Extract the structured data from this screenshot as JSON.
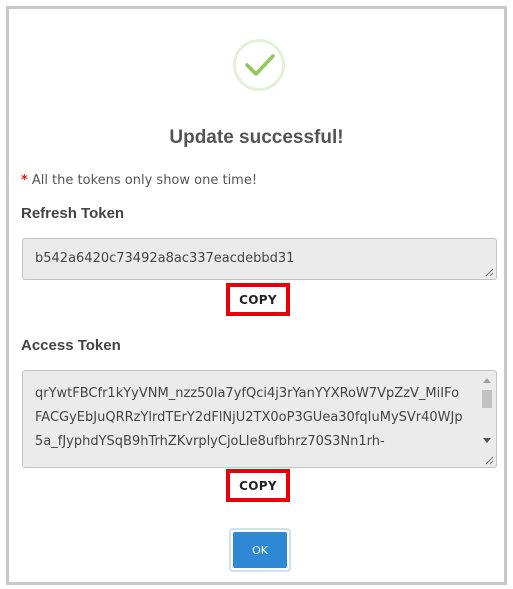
{
  "dialog": {
    "icon": "success-check-icon",
    "title": "Update successful!",
    "note": {
      "star": "*",
      "text": "All the tokens only show one time!"
    },
    "refresh_token": {
      "label": "Refresh Token",
      "value": "b542a6420c73492a8ac337eacdebbd31",
      "copy_label": "COPY"
    },
    "access_token": {
      "label": "Access Token",
      "lines": [
        "qrYwtFBCfr1kYyVNM_nzz50Ia7yfQci4j3rYanYYXRoW7VpZzV_MiIFo",
        "FACGyEbJuQRRzYlrdTErY2dFlNjU2TX0oP3GUea30fqIuMySVr40WJp",
        "5a_fJyphdYSqB9hTrhZKvrplyCjoLIe8ufbhrz70S3Nn1rh-"
      ],
      "copy_label": "COPY"
    },
    "ok_label": "OK"
  },
  "colors": {
    "accent": "#2f88d6",
    "highlight_border": "#e8000a",
    "success_check": "#8bc34a",
    "required_star": "#e02020"
  }
}
